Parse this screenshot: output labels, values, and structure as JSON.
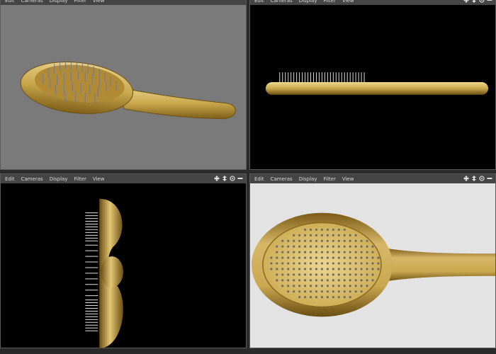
{
  "menu": [
    "Edit",
    "Cameras",
    "Display",
    "Filter",
    "View"
  ],
  "viewports": {
    "perspective": {
      "background": "#7a7a7a"
    },
    "side": {
      "background": "#000000"
    },
    "front": {
      "background": "#000000"
    },
    "top": {
      "background": "#e3e3e3"
    }
  },
  "colors": {
    "wood": "#c9a84c",
    "wood_dark": "#8a6a1e",
    "bristle": "#7a7a80"
  },
  "icons": [
    "move-icon",
    "dolly-icon",
    "zoom-icon",
    "maximize-icon"
  ]
}
